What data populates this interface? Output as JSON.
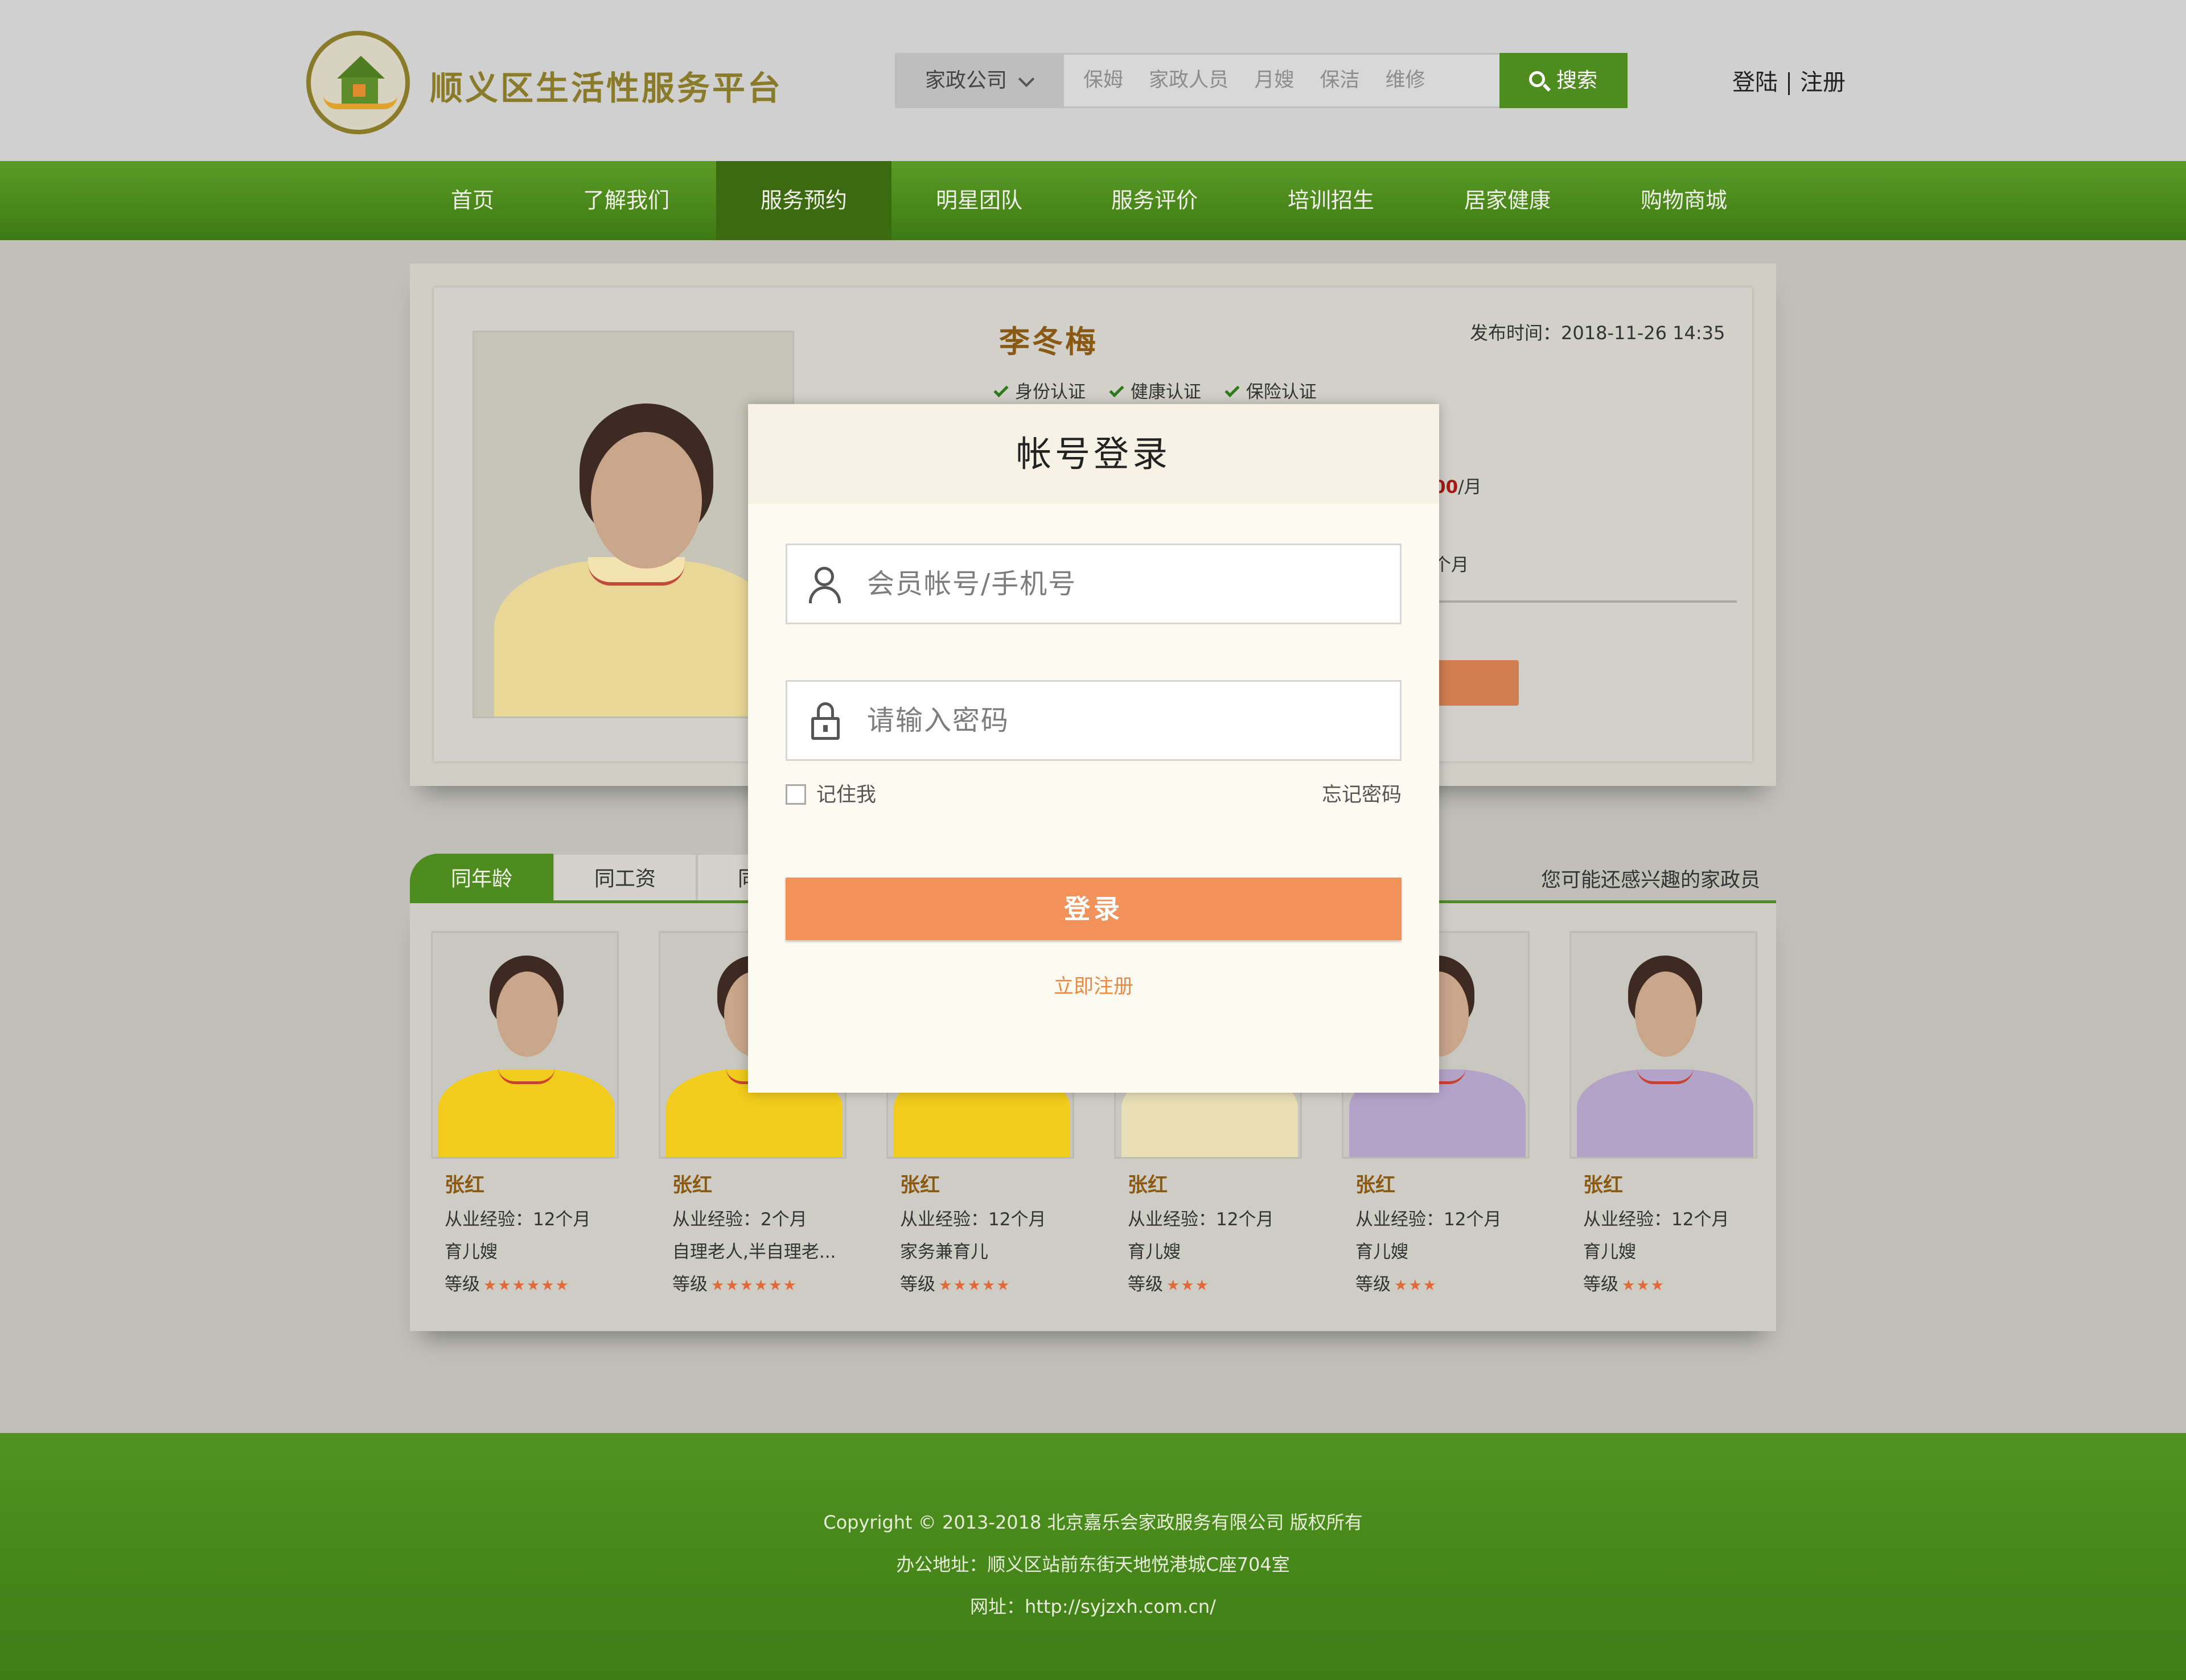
{
  "header": {
    "site_title": "顺义区生活性服务平台",
    "logo_icon": "house-hands-logo",
    "search": {
      "category": "家政公司",
      "tags": [
        "保姆",
        "家政人员",
        "月嫂",
        "保洁",
        "维修"
      ],
      "button_label": "搜索"
    },
    "login_link": "登陆",
    "register_link": "注册"
  },
  "nav": {
    "items": [
      "首页",
      "了解我们",
      "服务预约",
      "明星团队",
      "服务评价",
      "培训招生",
      "居家健康",
      "购物商城"
    ],
    "active_index": 2
  },
  "profile": {
    "name": "李冬梅",
    "publish_label": "发布时间：2018-11-26   14:35",
    "certs": [
      "身份认证",
      "健康认证",
      "保险认证"
    ],
    "salary_visible": "00",
    "salary_unit": "/月",
    "experience_visible": "个月"
  },
  "tabs": {
    "items": [
      "同年龄",
      "同工资",
      "同"
    ],
    "right_label": "您可能还感兴趣的家政员"
  },
  "cards": [
    {
      "name": "张红",
      "exp": "从业经验：12个月",
      "role": "育儿嫂",
      "level_label": "等级",
      "stars": "★★★★★★",
      "shirt": "#f2cc1c"
    },
    {
      "name": "张红",
      "exp": "从业经验：2个月",
      "role": "自理老人,半自理老...",
      "level_label": "等级",
      "stars": "★★★★★★",
      "shirt": "#f2cc1c"
    },
    {
      "name": "张红",
      "exp": "从业经验：12个月",
      "role": "家务兼育儿",
      "level_label": "等级",
      "stars": "★★★★★",
      "shirt": "#f2cc1c"
    },
    {
      "name": "张红",
      "exp": "从业经验：12个月",
      "role": "育儿嫂",
      "level_label": "等级",
      "stars": "★★★",
      "shirt": "#e8dfb6"
    },
    {
      "name": "张红",
      "exp": "从业经验：12个月",
      "role": "育儿嫂",
      "level_label": "等级",
      "stars": "★★★",
      "shirt": "#b4a3c8"
    },
    {
      "name": "张红",
      "exp": "从业经验：12个月",
      "role": "育儿嫂",
      "level_label": "等级",
      "stars": "★★★",
      "shirt": "#b4a3c8"
    }
  ],
  "login_modal": {
    "title": "帐号登录",
    "account_placeholder": "会员帐号/手机号",
    "password_placeholder": "请输入密码",
    "remember_label": "记住我",
    "forgot_label": "忘记密码",
    "submit_label": "登录",
    "register_label": "立即注册"
  },
  "footer": {
    "copyright": "Copyright © 2013-2018 北京嘉乐会家政服务有限公司 版权所有",
    "address": "办公地址：顺义区站前东街天地悦港城C座704室",
    "website": "网址：http://syjzxh.com.cn/"
  },
  "colors": {
    "brand_green": "#4e8c1f",
    "title_olive": "#8a7b2a",
    "accent_orange": "#f0925a",
    "name_brown": "#8a5a14",
    "star_orange": "#e06a3a"
  }
}
